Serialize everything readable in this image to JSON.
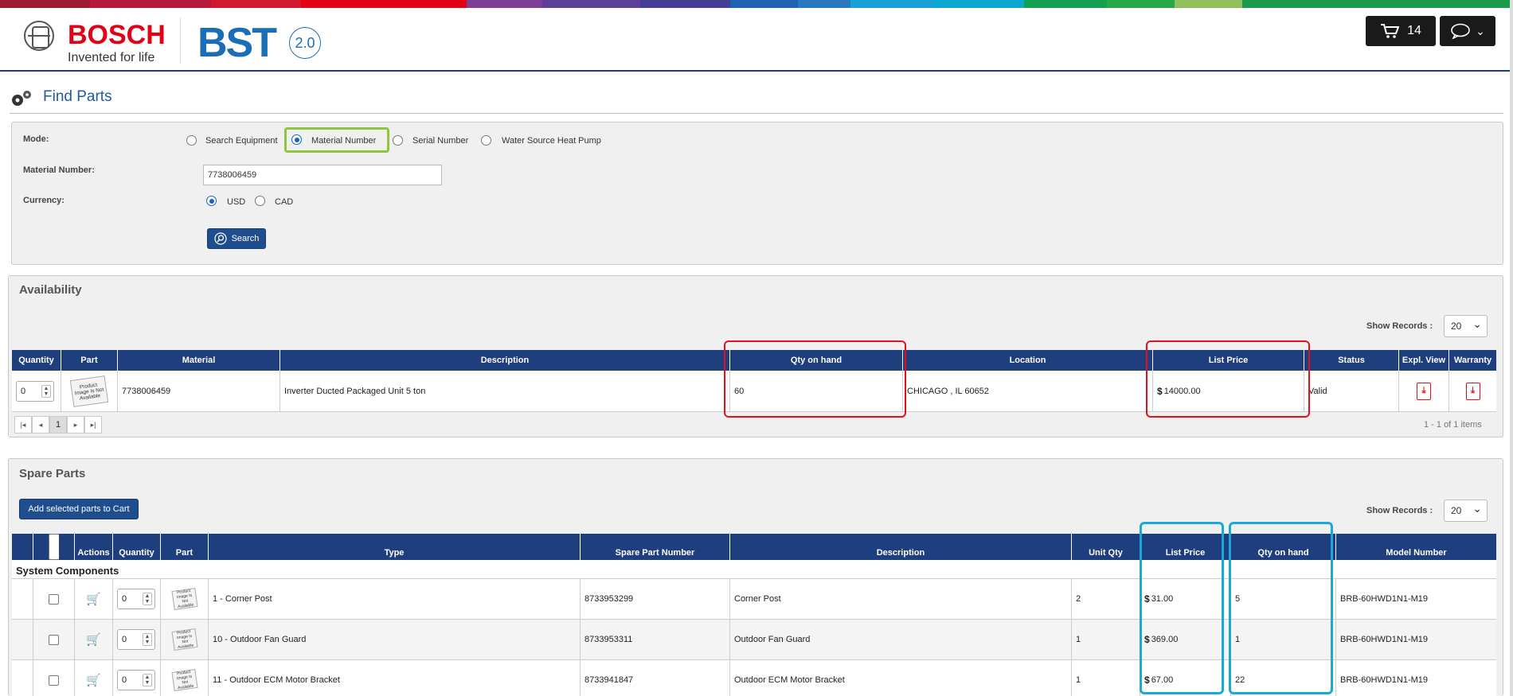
{
  "header": {
    "brand": "BOSCH",
    "tagline": "Invented for life",
    "app_logo": "BST",
    "app_version": "2.0",
    "cart_count": "14",
    "cart_icon": "shopping-cart-icon",
    "chat_icon": "chat-bubble-icon"
  },
  "colors": {
    "primary_blue": "#1f3e7e",
    "bosch_red": "#e20015",
    "highlight_green": "#8dc63f",
    "highlight_red": "#e4101e",
    "highlight_cyan": "#1aa7dc"
  },
  "page": {
    "title": "Find Parts",
    "icon": "gears-icon"
  },
  "search_form": {
    "mode_label": "Mode:",
    "modes": [
      "Search Equipment",
      "Material Number",
      "Serial Number",
      "Water Source Heat Pump"
    ],
    "selected_mode": "Material Number",
    "material_label": "Material Number:",
    "material_value": "7738006459",
    "currency_label": "Currency:",
    "currencies": [
      "USD",
      "CAD"
    ],
    "selected_currency": "USD",
    "search_button": "Search"
  },
  "availability": {
    "title": "Availability",
    "show_records_label": "Show Records :",
    "show_records_value": "20",
    "columns": [
      "Quantity",
      "Part",
      "Material",
      "Description",
      "Qty on hand",
      "Location",
      "List Price",
      "Status",
      "Expl. View",
      "Warranty"
    ],
    "rows": [
      {
        "quantity": "0",
        "part_image": "Product Image Is Not Available",
        "material": "7738006459",
        "description": "Inverter Ducted Packaged Unit 5 ton",
        "qty_on_hand": "60",
        "location": "CHICAGO , IL 60652",
        "currency_symbol": "$",
        "list_price": "14000.00",
        "status": "Valid"
      }
    ],
    "pager": {
      "current_page": "1",
      "info": "1 - 1 of 1 items"
    }
  },
  "spare_parts": {
    "title": "Spare Parts",
    "add_button": "Add selected parts to Cart",
    "show_records_label": "Show Records :",
    "show_records_value": "20",
    "columns": [
      "Actions",
      "Quantity",
      "Part",
      "Type",
      "Spare Part Number",
      "Description",
      "Unit Qty",
      "List Price",
      "Qty on hand",
      "Model Number"
    ],
    "group": "System Components",
    "rows": [
      {
        "quantity": "0",
        "part_image": "Product Image Is Not Available",
        "type": "1 - Corner Post",
        "spare_part_number": "8733953299",
        "description": "Corner Post",
        "unit_qty": "2",
        "currency_symbol": "$",
        "list_price": "31.00",
        "qty_on_hand": "5",
        "model_number": "BRB-60HWD1N1-M19"
      },
      {
        "quantity": "0",
        "part_image": "Product Image Is Not Available",
        "type": "10 - Outdoor Fan Guard",
        "spare_part_number": "8733953311",
        "description": "Outdoor Fan Guard",
        "unit_qty": "1",
        "currency_symbol": "$",
        "list_price": "369.00",
        "qty_on_hand": "1",
        "model_number": "BRB-60HWD1N1-M19"
      },
      {
        "quantity": "0",
        "part_image": "Product Image Is Not Available",
        "type": "11 - Outdoor ECM Motor Bracket",
        "spare_part_number": "8733941847",
        "description": "Outdoor ECM Motor Bracket",
        "unit_qty": "1",
        "currency_symbol": "$",
        "list_price": "67.00",
        "qty_on_hand": "22",
        "model_number": "BRB-60HWD1N1-M19"
      }
    ]
  }
}
